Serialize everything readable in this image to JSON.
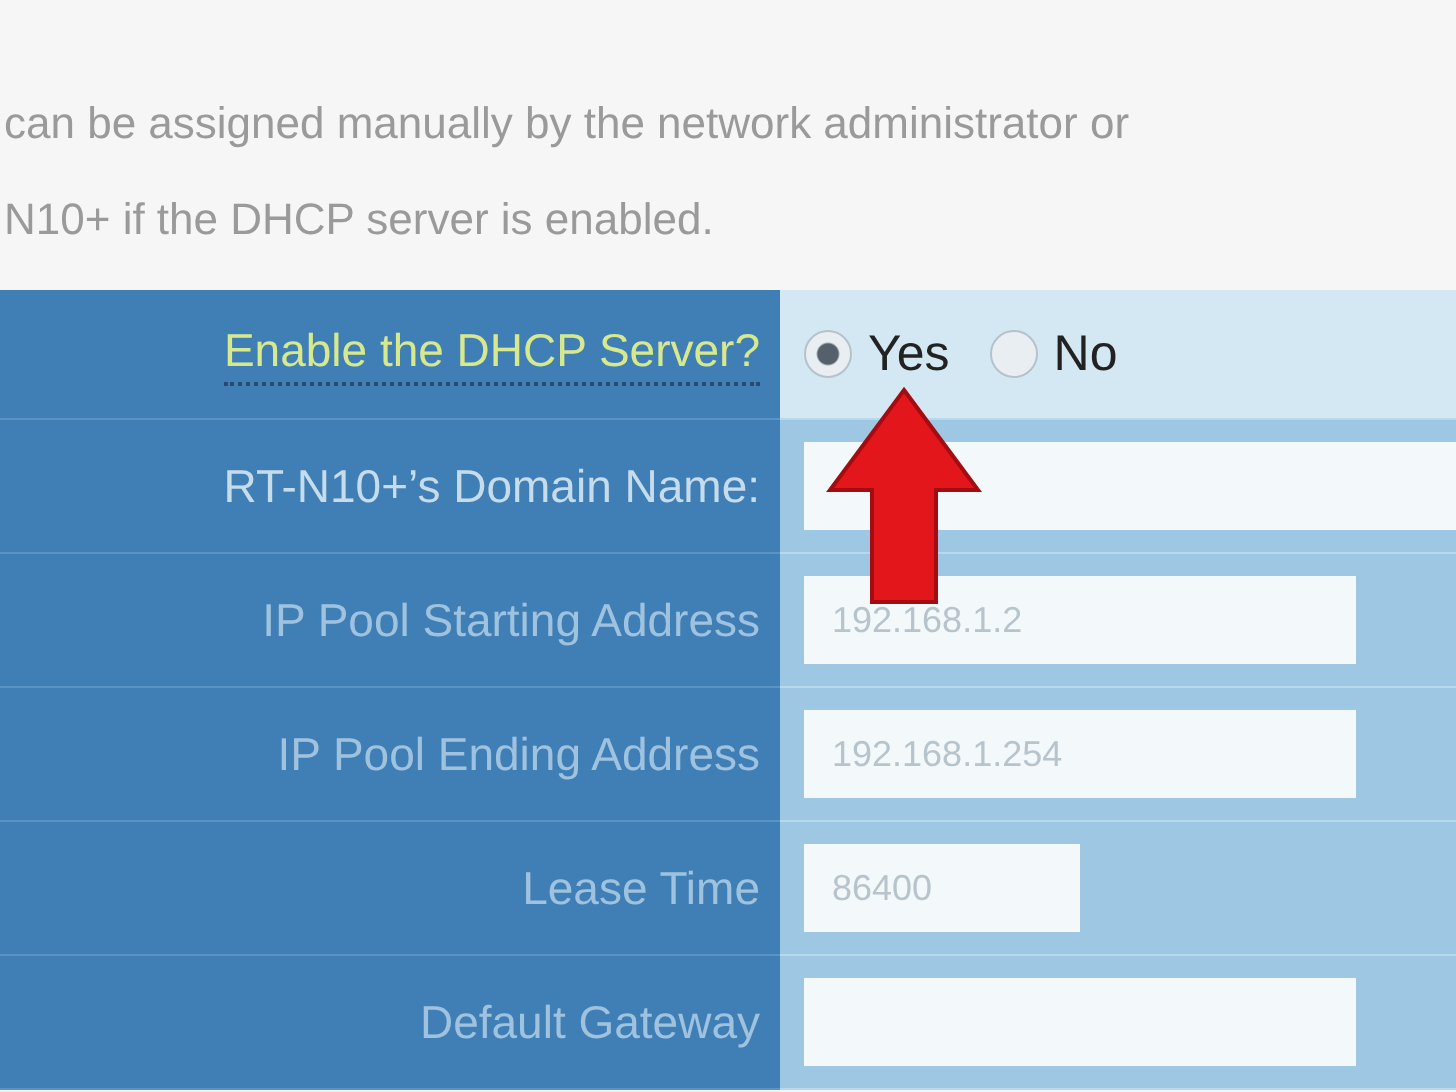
{
  "intro_lines": [
    "can be assigned manually by the network administrator or",
    "N10+ if the DHCP server is enabled."
  ],
  "form": {
    "rows": [
      {
        "kind": "radio",
        "label": "Enable the DHCP Server?",
        "options": [
          {
            "label": "Yes",
            "selected": true
          },
          {
            "label": "No",
            "selected": false
          }
        ]
      },
      {
        "kind": "text",
        "label": "RT-N10+’s Domain Name:"
      },
      {
        "kind": "text",
        "label": "IP Pool Starting Address",
        "value": "192.168.1.2"
      },
      {
        "kind": "text",
        "label": "IP Pool Ending Address",
        "value": "192.168.1.254"
      },
      {
        "kind": "short",
        "label": "Lease Time",
        "value": "86400"
      },
      {
        "kind": "text",
        "label": "Default Gateway"
      }
    ]
  }
}
